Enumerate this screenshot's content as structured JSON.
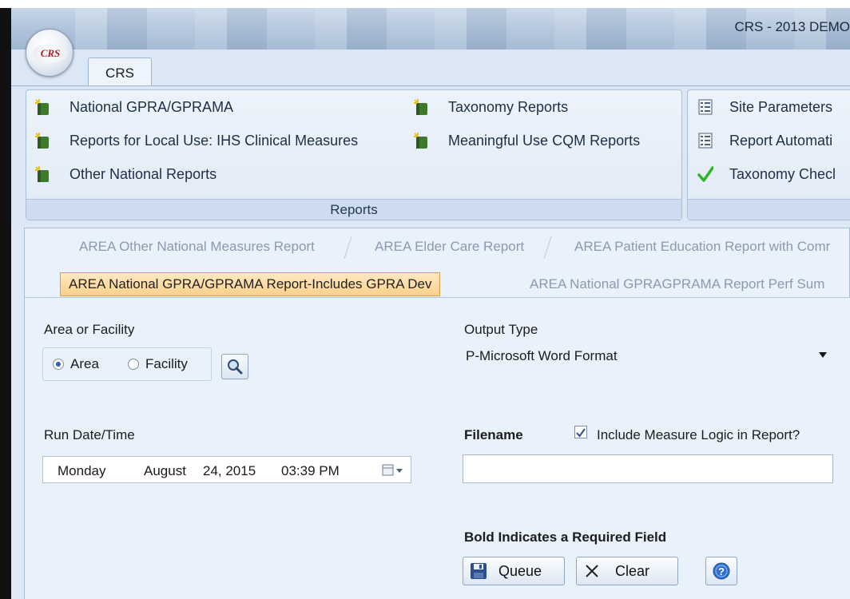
{
  "window": {
    "title": "CRS - 2013 DEMO",
    "orb_label": "CRS"
  },
  "ribbon": {
    "tab_label": "CRS",
    "reports_group": {
      "label": "Reports",
      "items": [
        {
          "label": "National GPRA/GPRAMA",
          "icon": "report-book-icon"
        },
        {
          "label": "Reports for Local Use: IHS Clinical Measures",
          "icon": "report-book-icon"
        },
        {
          "label": "Other National Reports",
          "icon": "report-book-icon"
        },
        {
          "label": "Taxonomy Reports",
          "icon": "report-book-icon"
        },
        {
          "label": "Meaningful Use CQM Reports",
          "icon": "report-book-icon"
        }
      ]
    },
    "settings_group": {
      "items": [
        {
          "label": "Site Parameters",
          "icon": "list-icon"
        },
        {
          "label": "Report Automati",
          "icon": "list-icon"
        },
        {
          "label": "Taxonomy Checl",
          "icon": "checkmark-icon"
        }
      ]
    }
  },
  "tabs": {
    "row1": [
      "AREA Other National Measures Report",
      "AREA Elder Care Report",
      "AREA Patient Education Report with Comr"
    ],
    "row2": [
      "AREA National GPRA/GPRAMA Report-Includes GPRA Dev",
      "AREA National GPRAGPRAMA Report Perf Sum"
    ],
    "active": "AREA National GPRA/GPRAMA Report-Includes GPRA Dev"
  },
  "form": {
    "area_or_facility_label": "Area or Facility",
    "area_option": "Area",
    "facility_option": "Facility",
    "selected_option": "Area",
    "output_type_label": "Output Type",
    "output_type_value": "P-Microsoft Word Format",
    "run_date_label": "Run Date/Time",
    "run_date": {
      "day": "Monday",
      "month": "August",
      "date": "24, 2015",
      "time": "03:39 PM"
    },
    "filename_label": "Filename",
    "filename_value": "",
    "include_logic_label": "Include Measure Logic in Report?",
    "include_logic_checked": true,
    "required_note": "Bold Indicates a Required Field",
    "queue_label": "Queue",
    "clear_label": "Clear"
  },
  "colors": {
    "active_tab": "#fbd08a",
    "ribbon_bg": "#dbe7f5",
    "panel_bg": "#e9f1fb",
    "checkmark": "#2fb52a"
  }
}
